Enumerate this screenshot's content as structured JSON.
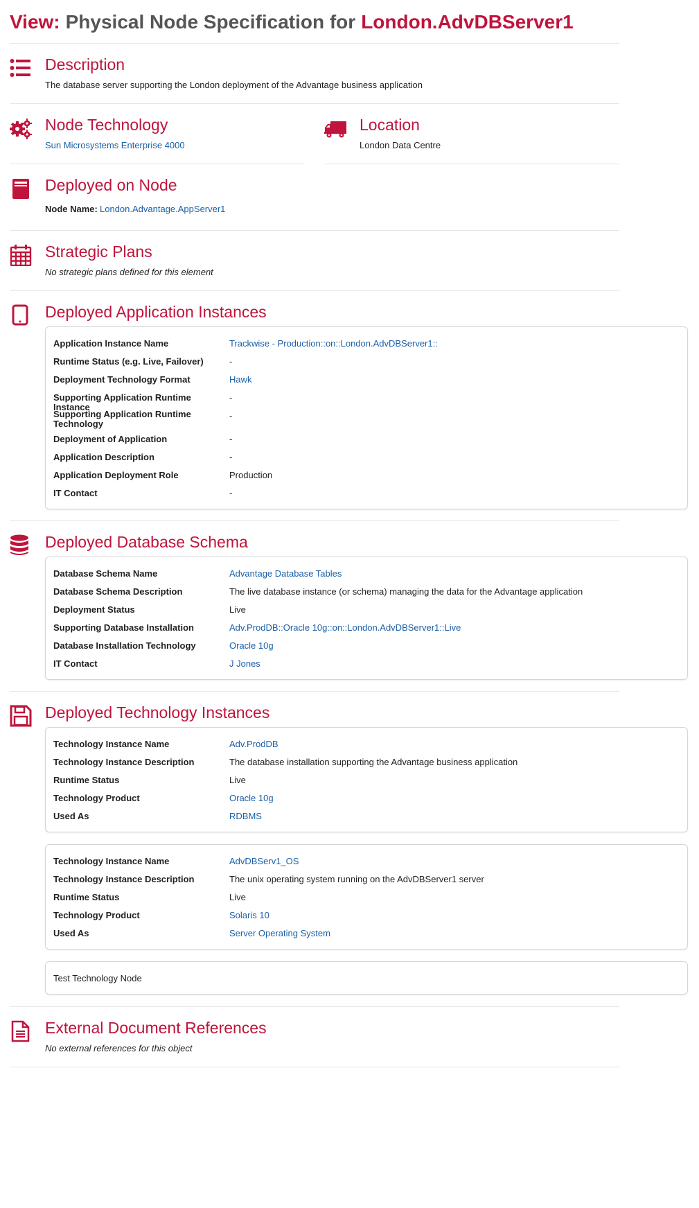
{
  "header": {
    "view_label": "View:",
    "title_mid": "Physical Node Specification for",
    "node_name": "London.AdvDBServer1"
  },
  "description": {
    "title": "Description",
    "text": "The database server supporting the London deployment of the Advantage business application",
    "icon": "list-icon"
  },
  "node_technology": {
    "title": "Node Technology",
    "value": "Sun Microsystems Enterprise 4000",
    "icon": "gears-icon"
  },
  "location": {
    "title": "Location",
    "value": "London Data Centre",
    "icon": "truck-icon"
  },
  "deployed_on_node": {
    "title": "Deployed on Node",
    "label": "Node Name:",
    "value": "London.Advantage.AppServer1",
    "icon": "server-icon"
  },
  "strategic_plans": {
    "title": "Strategic Plans",
    "text": "No strategic plans defined for this element",
    "icon": "calendar-icon"
  },
  "app_instances": {
    "title": "Deployed Application Instances",
    "icon": "tablet-icon",
    "rows": [
      {
        "k": "Application Instance Name",
        "v": "Trackwise - Production::on::London.AdvDBServer1::"
      },
      {
        "k": "Runtime Status (e.g. Live, Failover)",
        "v": "-"
      },
      {
        "k": "Deployment Technology Format",
        "v": "Hawk"
      },
      {
        "k": "Supporting Application Runtime Instance",
        "v": "-"
      },
      {
        "k": "Supporting Application Runtime Technology",
        "v": "-"
      },
      {
        "k": "Deployment of Application",
        "v": "-"
      },
      {
        "k": "Application Description",
        "v": "-"
      },
      {
        "k": "Application Deployment Role",
        "v": "Production"
      },
      {
        "k": "IT Contact",
        "v": "-"
      }
    ]
  },
  "db_schema": {
    "title": "Deployed Database Schema",
    "icon": "database-icon",
    "rows": [
      {
        "k": "Database Schema Name",
        "v": "Advantage Database Tables"
      },
      {
        "k": "Database Schema Description",
        "v": "The live database instance (or schema) managing the data for the Advantage application"
      },
      {
        "k": "Deployment Status",
        "v": "Live"
      },
      {
        "k": "Supporting Database Installation",
        "v": "Adv.ProdDB::Oracle 10g::on::London.AdvDBServer1::Live"
      },
      {
        "k": "Database Installation Technology",
        "v": "Oracle 10g"
      },
      {
        "k": "IT Contact",
        "v": "J Jones"
      }
    ]
  },
  "tech_instances": {
    "title": "Deployed Technology Instances",
    "icon": "floppy-disk-icon",
    "cards": [
      {
        "rows": [
          {
            "k": "Technology Instance Name",
            "v": "Adv.ProdDB"
          },
          {
            "k": "Technology Instance Description",
            "v": "The database installation supporting the Advantage business application"
          },
          {
            "k": "Runtime Status",
            "v": "Live"
          },
          {
            "k": "Technology Product",
            "v": "Oracle 10g"
          },
          {
            "k": "Used As",
            "v": "RDBMS"
          }
        ]
      },
      {
        "rows": [
          {
            "k": "Technology Instance Name",
            "v": "AdvDBServ1_OS"
          },
          {
            "k": "Technology Instance Description",
            "v": "The unix operating system running on the AdvDBServer1 server"
          },
          {
            "k": "Runtime Status",
            "v": "Live"
          },
          {
            "k": "Technology Product",
            "v": "Solaris 10"
          },
          {
            "k": "Used As",
            "v": "Server Operating System"
          }
        ]
      }
    ],
    "test_node": "Test Technology Node"
  },
  "external_docs": {
    "title": "External Document References",
    "text": "No external references for this object",
    "icon": "document-icon"
  },
  "colors": {
    "accent": "#c0143c",
    "link": "#1a5fa8",
    "heading_gray": "#555555"
  }
}
